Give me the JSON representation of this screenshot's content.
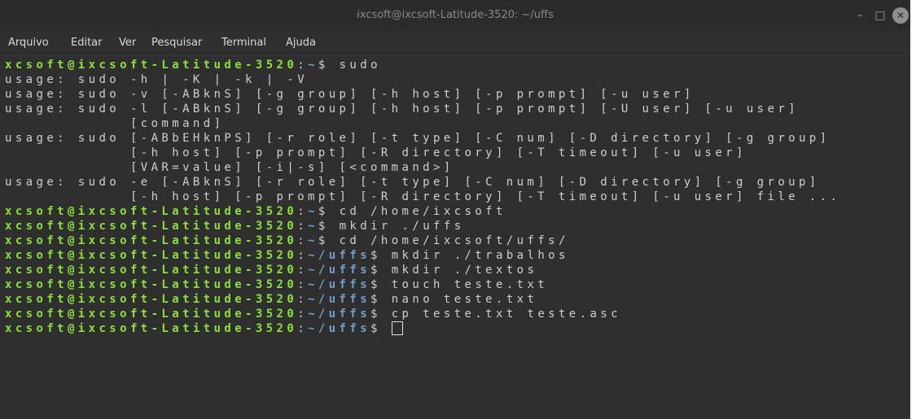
{
  "window": {
    "title": "ixcsoft@ixcsoft-Latitude-3520: ~/uffs",
    "minimize_glyph": "–",
    "maximize_glyph": "□",
    "close_glyph": "✕"
  },
  "menu": [
    "Arquivo",
    "Editar",
    "Ver",
    "Pesquisar",
    "Terminal",
    "Ajuda"
  ],
  "colors": {
    "background": "#2f2f2f",
    "user_host": "#8ae234",
    "path": "#729fcf",
    "text": "#cfcfcf"
  },
  "terminal": {
    "lines": [
      {
        "user": "xcsoft@ixcsoft-Latitude-3520",
        "path": "~",
        "cmd": "sudo"
      },
      {
        "text": "usage: sudo -h | -K | -k | -V"
      },
      {
        "text": "usage: sudo -v [-ABknS] [-g group] [-h host] [-p prompt] [-u user]"
      },
      {
        "text": "usage: sudo -l [-ABknS] [-g group] [-h host] [-p prompt] [-U user] [-u user]"
      },
      {
        "text": "            [command]"
      },
      {
        "text": "usage: sudo [-ABbEHknPS] [-r role] [-t type] [-C num] [-D directory] [-g group]"
      },
      {
        "text": "            [-h host] [-p prompt] [-R directory] [-T timeout] [-u user]"
      },
      {
        "text": "            [VAR=value] [-i|-s] [<command>]"
      },
      {
        "text": "usage: sudo -e [-ABknS] [-r role] [-t type] [-C num] [-D directory] [-g group]"
      },
      {
        "text": "            [-h host] [-p prompt] [-R directory] [-T timeout] [-u user] file ..."
      },
      {
        "user": "xcsoft@ixcsoft-Latitude-3520",
        "path": "~",
        "cmd": "cd /home/ixcsoft"
      },
      {
        "user": "xcsoft@ixcsoft-Latitude-3520",
        "path": "~",
        "cmd": "mkdir ./uffs"
      },
      {
        "user": "xcsoft@ixcsoft-Latitude-3520",
        "path": "~",
        "cmd": "cd /home/ixcsoft/uffs/"
      },
      {
        "user": "xcsoft@ixcsoft-Latitude-3520",
        "path": "~/uffs",
        "cmd": "mkdir ./trabalhos"
      },
      {
        "user": "xcsoft@ixcsoft-Latitude-3520",
        "path": "~/uffs",
        "cmd": "mkdir ./textos"
      },
      {
        "user": "xcsoft@ixcsoft-Latitude-3520",
        "path": "~/uffs",
        "cmd": "touch teste.txt"
      },
      {
        "user": "xcsoft@ixcsoft-Latitude-3520",
        "path": "~/uffs",
        "cmd": "nano teste.txt"
      },
      {
        "user": "xcsoft@ixcsoft-Latitude-3520",
        "path": "~/uffs",
        "cmd": "cp teste.txt teste.asc"
      },
      {
        "user": "xcsoft@ixcsoft-Latitude-3520",
        "path": "~/uffs",
        "cmd": "",
        "cursor": true
      }
    ]
  }
}
